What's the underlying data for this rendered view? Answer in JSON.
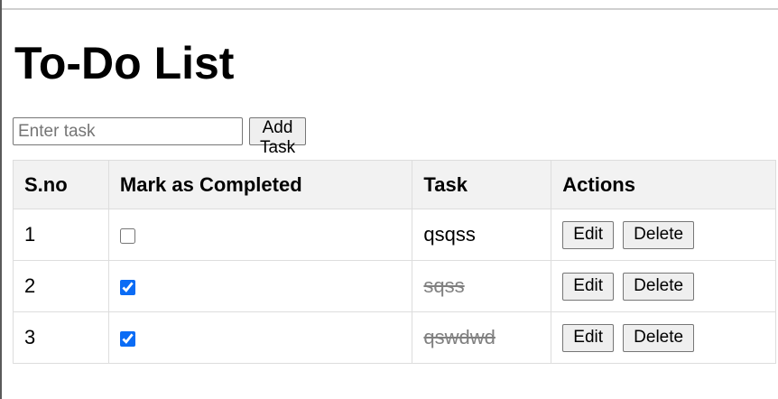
{
  "page": {
    "title": "To-Do List"
  },
  "form": {
    "input_placeholder": "Enter task",
    "input_value": "",
    "add_label": "Add Task"
  },
  "table": {
    "headers": {
      "sno": "S.no",
      "mark": "Mark as Completed",
      "task": "Task",
      "actions": "Actions"
    },
    "rows": [
      {
        "sno": "1",
        "completed": false,
        "task": "qsqss"
      },
      {
        "sno": "2",
        "completed": true,
        "task": "sqss"
      },
      {
        "sno": "3",
        "completed": true,
        "task": "qswdwd"
      }
    ],
    "edit_label": "Edit",
    "delete_label": "Delete"
  },
  "colors": {
    "checkbox_accent": "#0b6cf5",
    "completed_text": "#808080",
    "header_bg": "#f2f2f2",
    "button_bg": "#efefef"
  }
}
